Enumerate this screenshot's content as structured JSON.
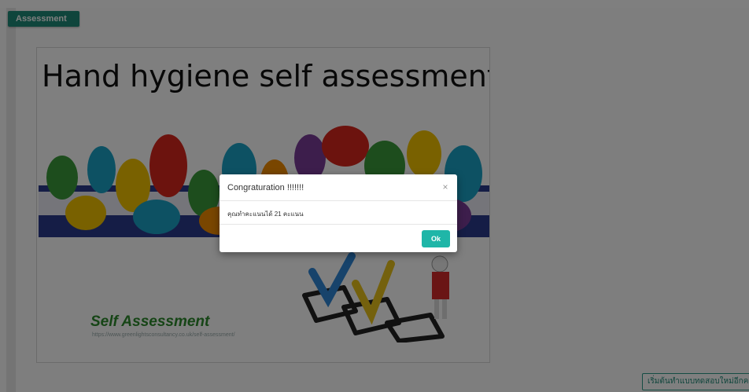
{
  "header": {
    "tab_label": "Assessment"
  },
  "slide": {
    "title": "Hand hygiene self assessment",
    "subtitle": "Self Assessment",
    "url": "https://www.greenlightsconsultancy.co.uk/self-assessment/"
  },
  "footer": {
    "restart_label": "เริ่มต้นทำแบบทดสอบใหม่อีกครั้ง"
  },
  "modal": {
    "title": "Congraturation !!!!!!!",
    "message": "คุณทำคะแนนได้ 21 คะแนน",
    "ok_label": "Ok",
    "close_glyph": "×"
  },
  "colors": {
    "accent": "#1f8a78",
    "ok_button": "#1fb6a8"
  }
}
